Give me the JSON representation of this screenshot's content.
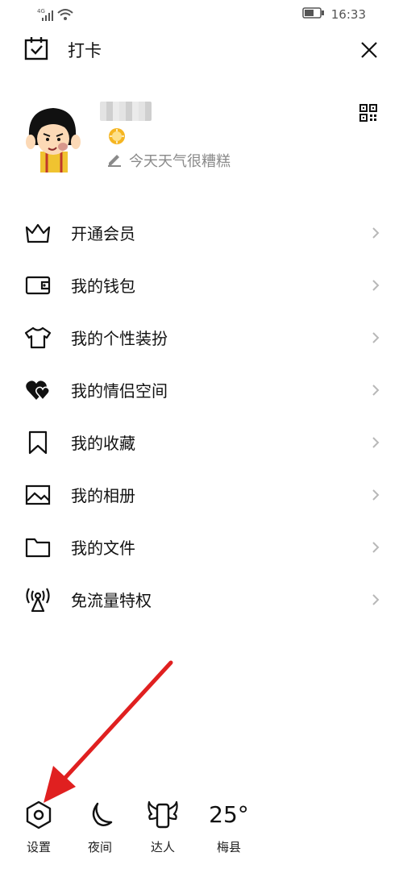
{
  "status_bar": {
    "network": "4G",
    "time": "16:33"
  },
  "header": {
    "checkin_label": "打卡",
    "checkin_icon": "calendar-check-icon",
    "close_icon": "close-icon"
  },
  "profile": {
    "signature": "今天天气很糟糕",
    "badge_icon": "sun-badge-icon",
    "qr_icon": "qr-code-icon"
  },
  "menu": {
    "items": [
      {
        "label": "开通会员",
        "icon": "crown-icon"
      },
      {
        "label": "我的钱包",
        "icon": "wallet-icon"
      },
      {
        "label": "我的个性装扮",
        "icon": "tshirt-icon"
      },
      {
        "label": "我的情侣空间",
        "icon": "hearts-icon"
      },
      {
        "label": "我的收藏",
        "icon": "bookmark-icon"
      },
      {
        "label": "我的相册",
        "icon": "photo-icon"
      },
      {
        "label": "我的文件",
        "icon": "folder-icon"
      },
      {
        "label": "免流量特权",
        "icon": "signal-tower-icon"
      }
    ]
  },
  "bottom_bar": {
    "settings_label": "设置",
    "night_label": "夜间",
    "expert_label": "达人",
    "temperature": "25°",
    "city": "梅县"
  },
  "colors": {
    "annotation_arrow": "#e02020",
    "text_primary": "#111111",
    "text_secondary": "#8a8a8a",
    "badge": "#f5b521"
  }
}
